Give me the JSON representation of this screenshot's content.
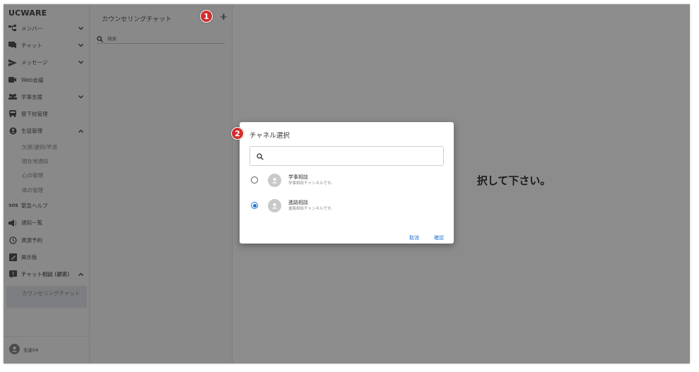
{
  "app": {
    "brand": "UCWARE"
  },
  "sidebar": {
    "items": [
      {
        "label": "メンバー",
        "icon": "members-icon",
        "chevron": "down"
      },
      {
        "label": "チャット",
        "icon": "chat-icon",
        "chevron": "down"
      },
      {
        "label": "メッセージ",
        "icon": "send-icon",
        "chevron": "down"
      },
      {
        "label": "Web会議",
        "icon": "video-icon",
        "chevron": ""
      },
      {
        "label": "学事支援",
        "icon": "group-icon",
        "chevron": "down"
      },
      {
        "label": "登下校管理",
        "icon": "bus-icon",
        "chevron": ""
      },
      {
        "label": "生徒管理",
        "icon": "student-icon",
        "chevron": "up"
      }
    ],
    "sub_items": [
      "欠席/遅刻/早退",
      "現在地通知",
      "心の管理",
      "体の管理"
    ],
    "items2": [
      {
        "label": "緊急ヘルプ",
        "icon": "sos-icon",
        "chevron": ""
      },
      {
        "label": "通知一覧",
        "icon": "megaphone-icon",
        "chevron": ""
      },
      {
        "label": "資源予約",
        "icon": "clock-icon",
        "chevron": ""
      },
      {
        "label": "掲示板",
        "icon": "board-icon",
        "chevron": ""
      },
      {
        "label": "チャット相談 (顧客)",
        "icon": "consult-icon",
        "chevron": "up"
      }
    ],
    "active_sub": "カウンセリングチャット",
    "user": "生徒04"
  },
  "list_pane": {
    "title": "カウンセリングチャット",
    "add_label": "+",
    "search_placeholder": "検索"
  },
  "main": {
    "empty_message": "択して下さい。"
  },
  "markers": [
    "1",
    "2"
  ],
  "dialog": {
    "title": "チャネル選択",
    "search_placeholder": "",
    "options": [
      {
        "name": "学事相談",
        "desc": "学事相談チャンネルです。",
        "selected": false
      },
      {
        "name": "進路相談",
        "desc": "進路相談チャンネルです。",
        "selected": true
      }
    ],
    "cancel_label": "取消",
    "confirm_label": "確認"
  },
  "colors": {
    "accent": "#1e72d8",
    "marker": "#d22e2e"
  }
}
